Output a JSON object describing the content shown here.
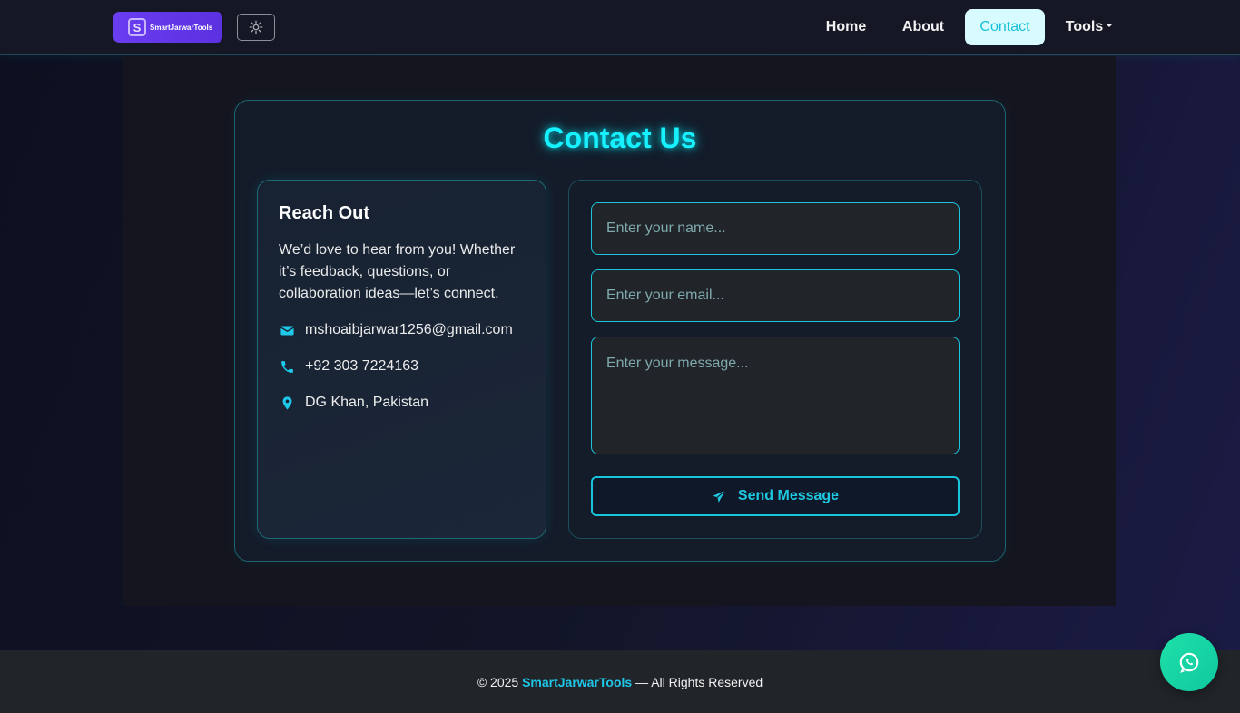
{
  "nav": {
    "logo_text": "SmartJarwarTools",
    "links": [
      {
        "label": "Home"
      },
      {
        "label": "About"
      },
      {
        "label": "Contact"
      },
      {
        "label": "Tools"
      }
    ]
  },
  "contact": {
    "title": "Contact Us",
    "info": {
      "heading": "Reach Out",
      "text": "We’d love to hear from you! Whether it’s feedback, questions, or collaboration ideas—let’s connect.",
      "email": "mshoaibjarwar1256@gmail.com",
      "phone": "+92 303 7224163",
      "location": "DG Khan, Pakistan"
    },
    "form": {
      "name_placeholder": "Enter your name...",
      "email_placeholder": "Enter your email...",
      "message_placeholder": "Enter your message...",
      "submit_label": "Send Message"
    }
  },
  "footer": {
    "prefix": "© 2025",
    "brand": "SmartJarwarTools",
    "suffix": "— All Rights Reserved"
  },
  "colors": {
    "accent": "#17f0ff",
    "brand_purple": "#6a3df0",
    "whatsapp": "#1ee0a8"
  },
  "icons": [
    "gear-icon",
    "envelope-icon",
    "phone-icon",
    "location-pin-icon",
    "paper-plane-icon",
    "whatsapp-icon"
  ]
}
